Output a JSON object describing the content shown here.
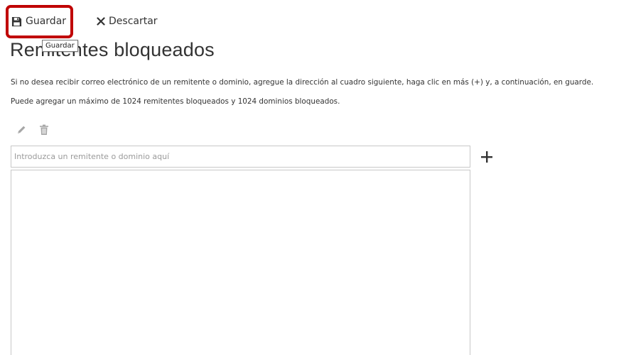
{
  "toolbar": {
    "save_label": "Guardar",
    "discard_label": "Descartar",
    "tooltip": "Guardar"
  },
  "colors": {
    "highlight": "#c00000",
    "text": "#333333",
    "border": "#c8c8c8"
  },
  "page": {
    "title": "Remitentes bloqueados",
    "description_1": "Si no desea recibir correo electrónico de un remitente o dominio, agregue la dirección al cuadro siguiente, haga clic en más (+) y, a continuación, en guarde.",
    "description_2": "Puede agregar un máximo de 1024 remitentes bloqueados y 1024 dominios bloqueados."
  },
  "entry": {
    "placeholder": "Introduzca un remitente o dominio aquí",
    "value": ""
  },
  "icons": {
    "save": "floppy-disk-icon",
    "discard": "x-icon",
    "edit": "pencil-icon",
    "delete": "trash-icon",
    "add": "plus-icon"
  },
  "blocked_list": []
}
